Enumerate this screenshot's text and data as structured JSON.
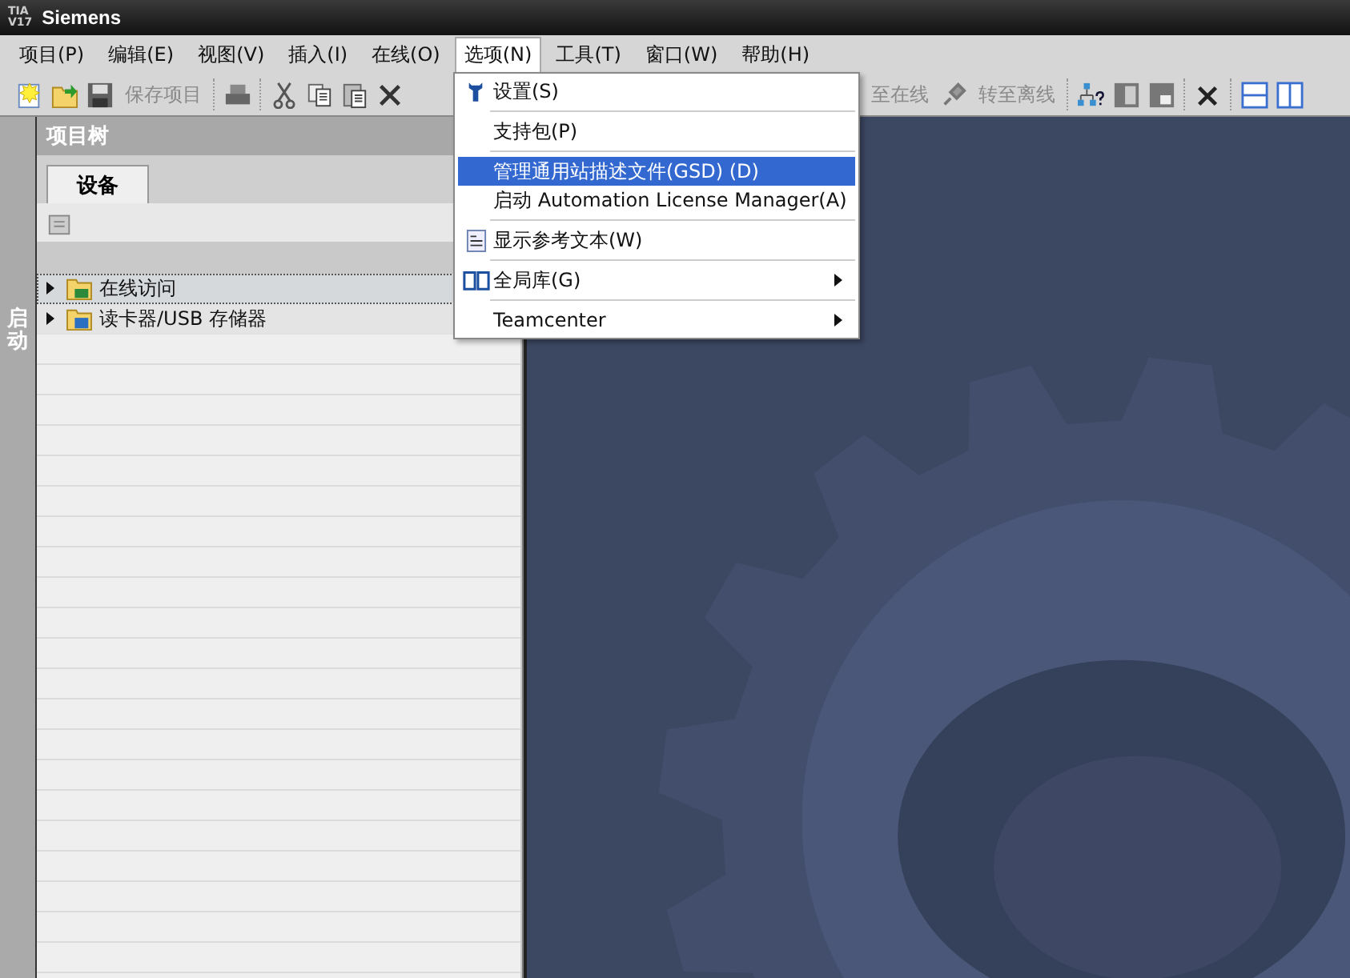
{
  "window": {
    "logo_lines": [
      "TIA",
      "V17"
    ],
    "title": "Siemens"
  },
  "menu_bar": [
    {
      "label": "项目(P)",
      "selected": false
    },
    {
      "label": "编辑(E)",
      "selected": false
    },
    {
      "label": "视图(V)",
      "selected": false
    },
    {
      "label": "插入(I)",
      "selected": false
    },
    {
      "label": "在线(O)",
      "selected": false
    },
    {
      "label": "选项(N)",
      "selected": true
    },
    {
      "label": "工具(T)",
      "selected": false
    },
    {
      "label": "窗口(W)",
      "selected": false
    },
    {
      "label": "帮助(H)",
      "selected": false
    }
  ],
  "toolbar": {
    "save_label": "保存项目",
    "go_online_label": "至在线",
    "go_offline_label": "转至离线"
  },
  "side_strip": {
    "label": "启动"
  },
  "project_tree": {
    "title": "项目树",
    "tabs": [
      {
        "label": "设备",
        "selected": true
      }
    ],
    "items": [
      {
        "label": "在线访问",
        "selected": true,
        "expanded": false
      },
      {
        "label": "读卡器/USB 存储器",
        "selected": false,
        "expanded": false
      }
    ]
  },
  "options_menu": [
    {
      "kind": "iconed",
      "label": "设置(S)",
      "highlighted": false
    },
    {
      "kind": "separator"
    },
    {
      "kind": "plain",
      "label": "支持包(P)",
      "highlighted": false
    },
    {
      "kind": "separator"
    },
    {
      "kind": "plain",
      "label": "管理通用站描述文件(GSD) (D)",
      "highlighted": true
    },
    {
      "kind": "plain",
      "label": "启动 Automation License Manager(A)",
      "highlighted": false
    },
    {
      "kind": "separator"
    },
    {
      "kind": "iconed",
      "label": "显示参考文本(W)",
      "highlighted": false
    },
    {
      "kind": "separator"
    },
    {
      "kind": "submenu-iconed",
      "label": "全局库(G)",
      "highlighted": false
    },
    {
      "kind": "separator"
    },
    {
      "kind": "submenu",
      "label": "Teamcenter",
      "highlighted": false
    }
  ]
}
